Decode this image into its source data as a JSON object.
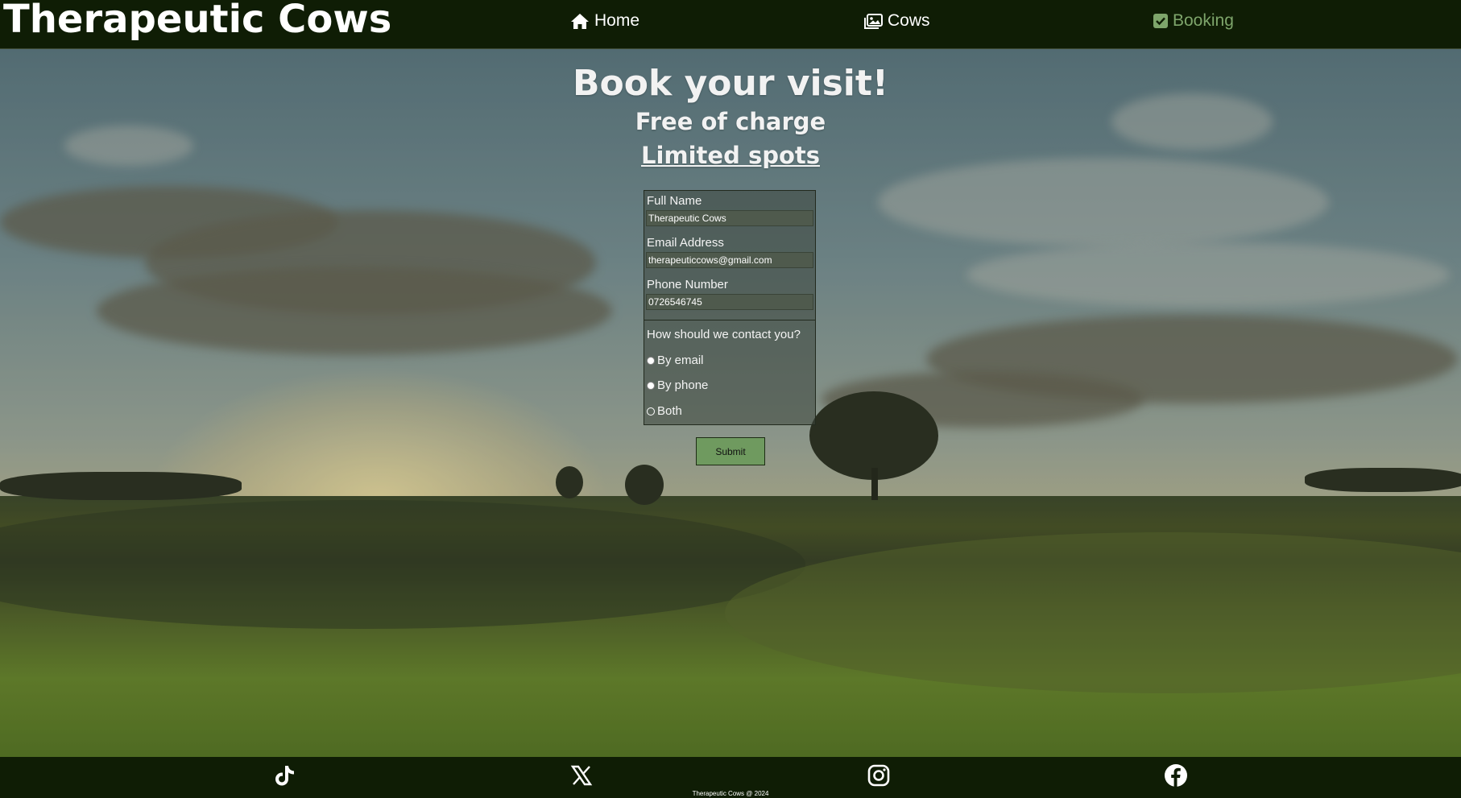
{
  "header": {
    "logo": "Therapeutic Cows",
    "nav": [
      {
        "label": "Home",
        "icon": "home-icon"
      },
      {
        "label": "Cows",
        "icon": "images-icon"
      },
      {
        "label": "Booking",
        "icon": "checkbox-icon",
        "active": true
      }
    ]
  },
  "hero": {
    "title": "Book your visit!",
    "subtitle": "Free of charge",
    "limited": "Limited spots"
  },
  "form": {
    "full_name": {
      "label": "Full Name",
      "value": "Therapeutic Cows"
    },
    "email": {
      "label": "Email Address",
      "value": "therapeuticcows@gmail.com"
    },
    "phone": {
      "label": "Phone Number",
      "value": "0726546745"
    },
    "contact_question": "How should we contact you?",
    "contact_options": [
      {
        "label": "By email"
      },
      {
        "label": "By phone"
      },
      {
        "label": "Both"
      }
    ],
    "submit_label": "Submit"
  },
  "footer": {
    "social": [
      "tiktok-icon",
      "x-twitter-icon",
      "instagram-icon",
      "facebook-icon"
    ],
    "copyright": "Therapeutic Cows @ 2024"
  },
  "colors": {
    "header_bg": "#0f1d05",
    "active_nav": "#7ea56b",
    "submit_bg": "#6f9a5f"
  }
}
